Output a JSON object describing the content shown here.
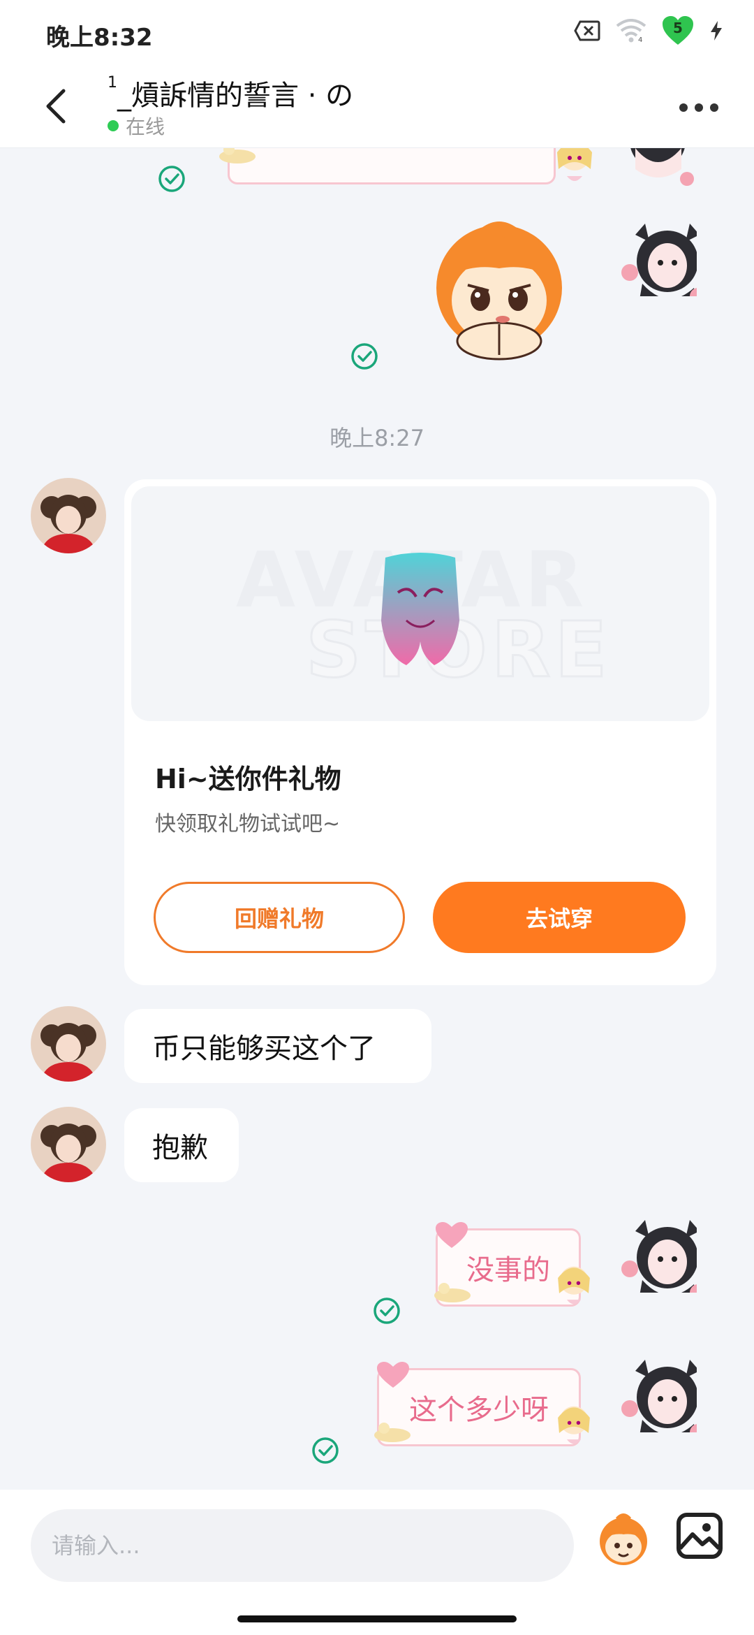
{
  "status_bar": {
    "time": "晚上8:32",
    "battery_level": "5",
    "icons": [
      "sim-off-icon",
      "wifi-icon",
      "battery-heart-icon",
      "charging-icon"
    ]
  },
  "header": {
    "peer_name": "_熕訴情的誓言 · の",
    "peer_name_prefix": "1",
    "status": "在线",
    "status_color": "#2ecc55"
  },
  "messages": {
    "time_divider": "晚上8:27",
    "gift": {
      "title": "Hi~送你件礼物",
      "subtitle": "快领取礼物试试吧~",
      "watermark_line1": "AVATAR",
      "watermark_line2": "STORE",
      "return_gift_label": "回赠礼物",
      "try_on_label": "去试穿"
    },
    "incoming": [
      {
        "text": "币只能够买这个了"
      },
      {
        "text": "抱歉"
      }
    ],
    "outgoing": [
      {
        "text": "没事的"
      },
      {
        "text": "这个多少呀"
      }
    ]
  },
  "input": {
    "placeholder": "请输入..."
  },
  "colors": {
    "accent": "#ff7a1f",
    "read_check": "#1aa67a",
    "deco_text": "#e86b8c"
  }
}
